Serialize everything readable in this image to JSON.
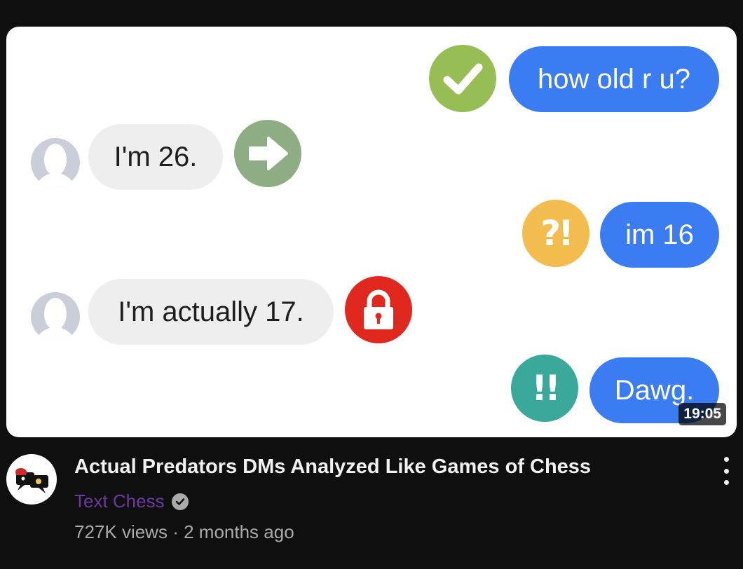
{
  "video": {
    "title": "Actual Predators DMs Analyzed Like Games of Chess",
    "channel": "Text Chess",
    "views": "727K views",
    "separator": "·",
    "age": "2 months ago",
    "duration": "19:05"
  },
  "thumbnail": {
    "messages": [
      {
        "side": "out",
        "text": "how old r u?",
        "badge_icon": "checkmark-icon",
        "badge_color": "#97bd55"
      },
      {
        "side": "in",
        "text": "I'm 26.",
        "badge_icon": "arrow-right-icon",
        "badge_color": "#8fad84"
      },
      {
        "side": "out",
        "text": "im 16",
        "badge_icon": "interrobang-icon",
        "badge_text": "?!",
        "badge_color": "#f2bd4e"
      },
      {
        "side": "in",
        "text": "I'm actually 17.",
        "badge_icon": "lock-icon",
        "badge_color": "#e0281f"
      },
      {
        "side": "out",
        "text": "Dawg.",
        "badge_icon": "double-exclamation-icon",
        "badge_text": "!!",
        "badge_color": "#3ba89c"
      }
    ]
  },
  "colors": {
    "background": "#0f0f0f",
    "outgoing_bubble": "#3b7cf2",
    "incoming_bubble": "#eeeeee",
    "channel_name": "#6b3aa0"
  }
}
